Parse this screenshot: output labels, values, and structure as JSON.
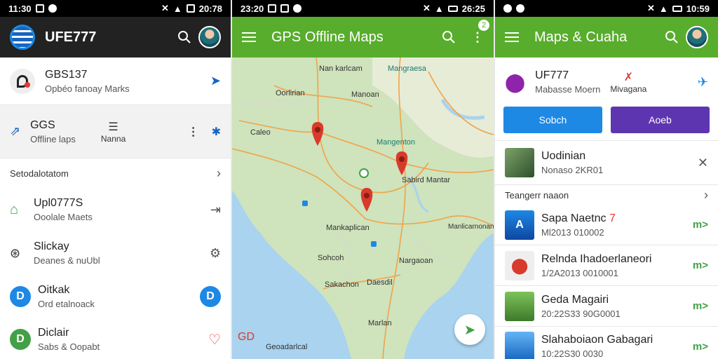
{
  "colors": {
    "panel1_appbar": "#222222",
    "panel2_appbar": "#58ad2c",
    "panel3_appbar": "#58ad2c",
    "blue_button": "#1e88e5",
    "purple_button": "#5e35b1",
    "accent_green": "#43a047"
  },
  "panel1": {
    "status": {
      "time": "11:30",
      "right_time": "20:78"
    },
    "appbar": {
      "title": "UFE777"
    },
    "header_item": {
      "title": "GBS137",
      "subtitle": "Opbéo fanoay Marks",
      "icon": "pin-icon"
    },
    "selected_item": {
      "title": "GGS",
      "subtitle": "Offline laps",
      "action_label": "Nanna"
    },
    "section_label": "Setodalotatom",
    "items": [
      {
        "title": "Upl0777S",
        "subtitle": "Ooolale Maets",
        "icon": "home-icon",
        "trail": "route-icon"
      },
      {
        "title": "Slickay",
        "subtitle": "Deanes & nuUbl",
        "icon": "compass-icon",
        "trail": "gear-icon"
      },
      {
        "title": "Oitkak",
        "subtitle": "Ord etalnoack",
        "icon": "d-badge-icon",
        "trail": "d-badge-icon"
      },
      {
        "title": "Diclair",
        "subtitle": "Sabs & Oopabt",
        "icon": "d-badge-icon",
        "trail": "heart-icon"
      }
    ]
  },
  "panel2": {
    "status": {
      "time": "23:20",
      "right_time": "26:25"
    },
    "appbar": {
      "title": "GPS Offline Maps",
      "badge": "2"
    },
    "map_labels": [
      "Nan karlcam",
      "Mangraesa",
      "Oorlirian",
      "Manoan",
      "Caleo",
      "Mangenton",
      "Sabird Mantar",
      "Mankaplican",
      "Manlicarnonan",
      "Sohcoh",
      "Nargaoan",
      "Sakachon",
      "Daesdil",
      "Marlan",
      "Geoadarlcal"
    ],
    "corner_label": "GD"
  },
  "panel3": {
    "status": {
      "time": "",
      "right_time": "10:59"
    },
    "appbar": {
      "title": "Maps & Cuaha"
    },
    "info": {
      "title": "UF777",
      "subtitle": "Mabasse Moern",
      "feature_label": "Mivagana"
    },
    "buttons": {
      "primary": "Sobch",
      "secondary": "Aoeb"
    },
    "recent": {
      "title": "Uodinian",
      "subtitle": "Nonaso 2KR01"
    },
    "section_label": "Teangerr naaon",
    "items": [
      {
        "title": "Sapa Naetnc",
        "badge": "7",
        "subtitle": "Ml2013 010002",
        "tag": "m>"
      },
      {
        "title": "Relnda Ihadoerlaneori",
        "subtitle": "1/2A2013 0010001",
        "tag": "m>"
      },
      {
        "title": "Geda Magairi",
        "subtitle": "20:22S33 90G0001",
        "tag": "m>"
      },
      {
        "title": "Slahaboiaon Gabagari",
        "subtitle": "10:22S30 0030",
        "tag": "m>"
      }
    ]
  }
}
